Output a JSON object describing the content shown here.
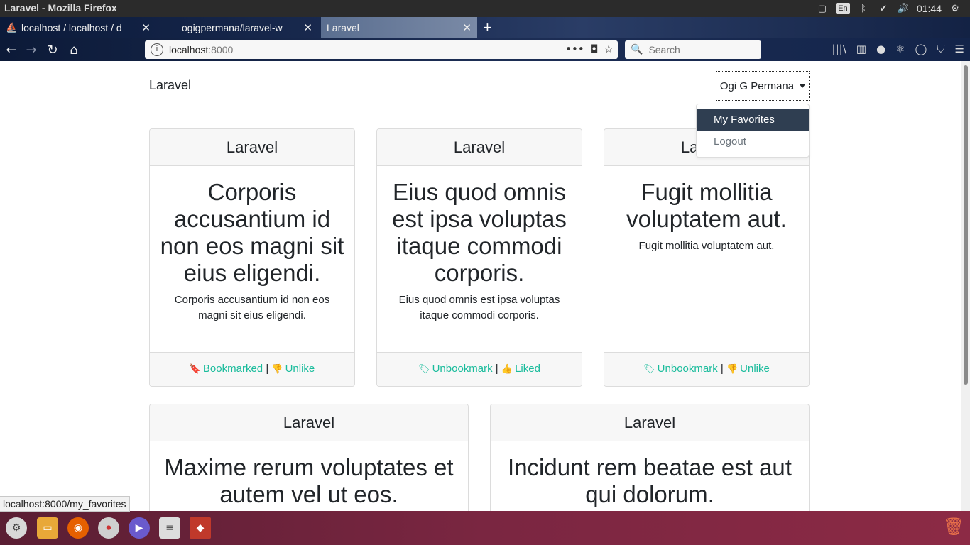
{
  "window": {
    "title": "Laravel - Mozilla Firefox"
  },
  "tray": {
    "lang": "En",
    "clock": "01:44"
  },
  "tabs": [
    {
      "label": "localhost / localhost / d"
    },
    {
      "label": "ogigpermana/laravel-w"
    },
    {
      "label": "Laravel"
    }
  ],
  "nav": {
    "url_host": "localhost",
    "url_port": ":8000",
    "search_placeholder": "Search"
  },
  "app": {
    "brand": "Laravel",
    "user_name": "Ogi G Permana",
    "menu": [
      {
        "label": "My Favorites"
      },
      {
        "label": "Logout"
      }
    ]
  },
  "cards": [
    {
      "header": "Laravel",
      "title": "Corporis accusantium id non eos magni sit eius eligendi.",
      "body": "Corporis accusantium id non eos magni sit eius eligendi.",
      "bookmark": "Bookmarked",
      "like": "Unlike",
      "bookmark_icon": "bookmark-solid-icon",
      "like_icon": "thumbs-down-icon"
    },
    {
      "header": "Laravel",
      "title": "Eius quod omnis est ipsa voluptas itaque commodi corporis.",
      "body": "Eius quod omnis est ipsa voluptas itaque commodi corporis.",
      "bookmark": "Unbookmark",
      "like": "Liked",
      "bookmark_icon": "bookmark-outline-icon",
      "like_icon": "thumbs-up-icon"
    },
    {
      "header": "Laravel",
      "title": "Fugit mollitia voluptatem aut.",
      "body": "Fugit mollitia voluptatem aut.",
      "bookmark": "Unbookmark",
      "like": "Unlike",
      "bookmark_icon": "bookmark-outline-icon",
      "like_icon": "thumbs-down-icon"
    },
    {
      "header": "Laravel",
      "title": "Maxime rerum voluptates et autem vel ut eos.",
      "body": "",
      "bookmark": "",
      "like": ""
    },
    {
      "header": "Laravel",
      "title": "Incidunt rem beatae est aut qui dolorum.",
      "body": "",
      "bookmark": "",
      "like": ""
    }
  ],
  "footer_sep": "|",
  "status": {
    "text": "localhost:8000/my_favorites"
  },
  "colors": {
    "accent": "#1abc9c",
    "dropdown_active": "#2f3e51"
  }
}
